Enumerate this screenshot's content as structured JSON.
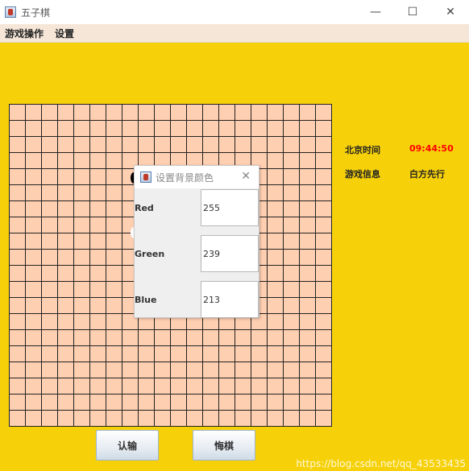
{
  "window": {
    "title": "五子棋",
    "minimize_glyph": "—",
    "maximize_glyph": "☐",
    "close_glyph": "✕"
  },
  "menu": {
    "items": [
      {
        "label": "游戏操作"
      },
      {
        "label": "设置"
      }
    ]
  },
  "board": {
    "grid_lines": 20,
    "background_color": "#ffcfb1",
    "line_color": "#222222"
  },
  "info": {
    "time_label": "北京时间",
    "time_value": "09:44:50",
    "game_label": "游戏信息",
    "game_value": "白方先行",
    "time_color": "#ff0000"
  },
  "buttons": {
    "concede": "认输",
    "undo": "悔棋"
  },
  "dialog": {
    "title": "设置背景颜色",
    "close_glyph": "✕",
    "fields": [
      {
        "label": "Red",
        "value": "255"
      },
      {
        "label": "Green",
        "value": "239"
      },
      {
        "label": "Blue",
        "value": "213"
      }
    ]
  },
  "colors": {
    "frame_background": "#f6d10a",
    "menubar_background": "#f5e6d8"
  },
  "watermark": "https://blog.csdn.net/qq_43533435"
}
